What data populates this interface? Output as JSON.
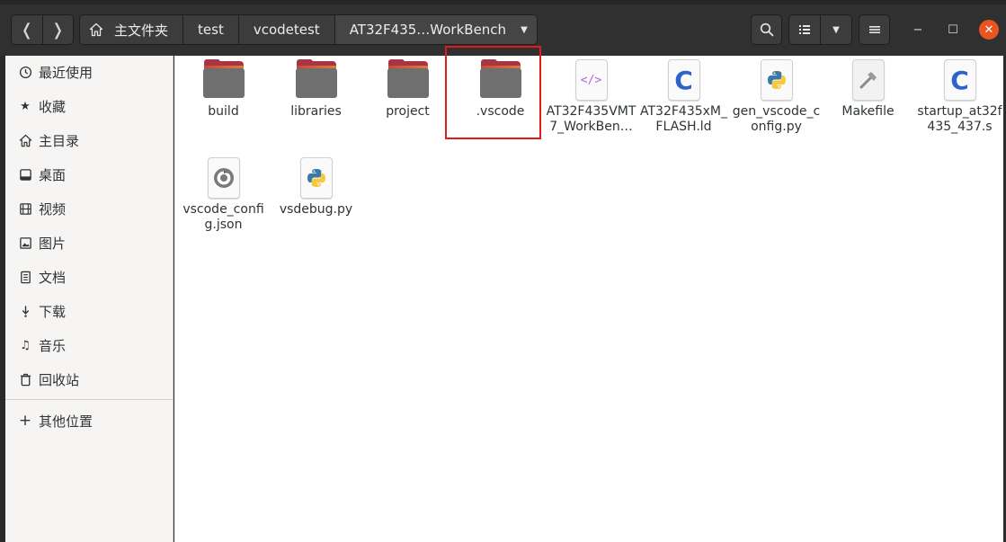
{
  "header": {
    "back_glyph": "❬",
    "forward_glyph": "❭",
    "breadcrumbs": [
      {
        "label": "主文件夹",
        "icon": "home-icon"
      },
      {
        "label": "test"
      },
      {
        "label": "vcodetest"
      },
      {
        "label": "AT32F435…WorkBench"
      }
    ],
    "window_controls": {
      "minimize": "−",
      "maximize": "☐",
      "close": "✕"
    },
    "accent_color": "#e95420"
  },
  "sidebar": {
    "items": [
      {
        "label": "最近使用",
        "icon": "clock-icon"
      },
      {
        "label": "收藏",
        "icon": "star-icon"
      },
      {
        "label": "主目录",
        "icon": "home-icon"
      },
      {
        "label": "桌面",
        "icon": "desktop-icon"
      },
      {
        "label": "视频",
        "icon": "video-icon"
      },
      {
        "label": "图片",
        "icon": "image-icon"
      },
      {
        "label": "文档",
        "icon": "document-icon"
      },
      {
        "label": "下载",
        "icon": "download-icon"
      },
      {
        "label": "音乐",
        "icon": "music-icon"
      },
      {
        "label": "回收站",
        "icon": "trash-icon"
      }
    ],
    "other_locations": {
      "label": "其他位置",
      "icon": "plus-icon"
    }
  },
  "files": [
    {
      "name": "build",
      "type": "folder"
    },
    {
      "name": "libraries",
      "type": "folder"
    },
    {
      "name": "project",
      "type": "folder"
    },
    {
      "name": ".vscode",
      "type": "folder",
      "highlighted": true
    },
    {
      "name": "AT32F435VMT7_WorkBen…",
      "type": "html-icon"
    },
    {
      "name": "AT32F435xM_FLASH.ld",
      "type": "c-source-icon"
    },
    {
      "name": "gen_vscode_config.py",
      "type": "python-icon"
    },
    {
      "name": "Makefile",
      "type": "makefile-icon"
    },
    {
      "name": "startup_at32f435_437.s",
      "type": "c-source-icon"
    },
    {
      "name": "vscode_config.json",
      "type": "json-icon"
    },
    {
      "name": "vsdebug.py",
      "type": "python-icon"
    }
  ]
}
